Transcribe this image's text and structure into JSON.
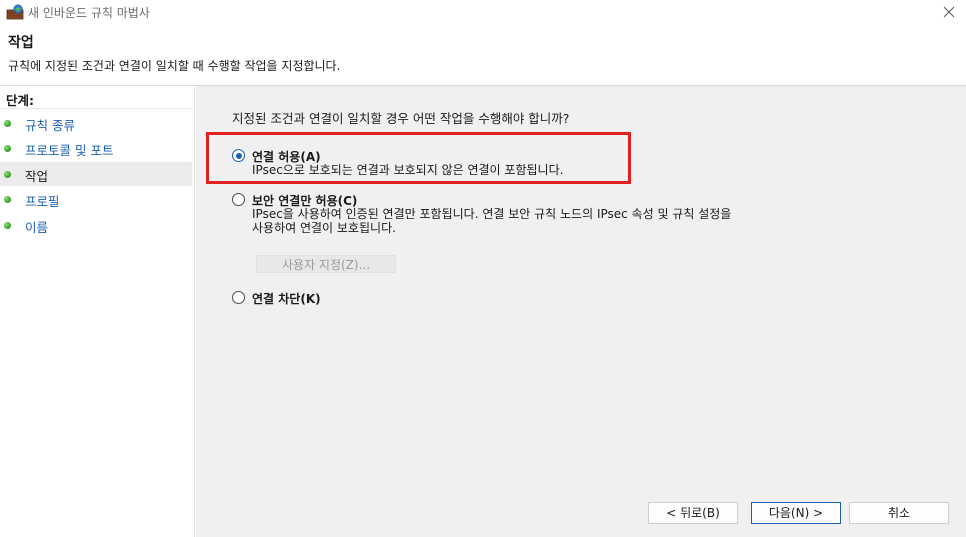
{
  "window": {
    "title": "새 인바운드 규칙 마법사"
  },
  "header": {
    "title": "작업",
    "description": "규칙에 지정된 조건과 연결이 일치할 때 수행할 작업을 지정합니다."
  },
  "sidebar": {
    "steps_label": "단계:",
    "items": [
      {
        "label": "규칙 종류",
        "active": false
      },
      {
        "label": "프로토콜 및 포트",
        "active": false
      },
      {
        "label": "작업",
        "active": true
      },
      {
        "label": "프로필",
        "active": false
      },
      {
        "label": "이름",
        "active": false
      }
    ]
  },
  "main": {
    "question": "지정된 조건과 연결이 일치할 경우 어떤 작업을 수행해야 합니까?",
    "options": [
      {
        "label": "연결 허용(A)",
        "desc1": "IPsec으로 보호되는 연결과 보호되지 않은 연결이 포함됩니다.",
        "checked": true
      },
      {
        "label": "보안 연결만 허용(C)",
        "desc1": "IPsec을 사용하여 인증된 연결만 포함됩니다. 연결 보안 규칙 노드의 IPsec 속성 및 규칙 설정을",
        "desc2": "사용하여 연결이 보호됩니다.",
        "checked": false
      },
      {
        "label": "연결 차단(K)",
        "checked": false
      }
    ],
    "custom_button": "사용자 지정(Z)..."
  },
  "footer": {
    "back": "< 뒤로(B)",
    "next": "다음(N) >",
    "cancel": "취소"
  },
  "colors": {
    "accent": "#1a5fb4",
    "highlight": "#e02020",
    "step_dot": "#3aa52a",
    "panel_bg": "#f0f0f0"
  },
  "icons": {
    "app": "firewall-icon",
    "close": "close-icon",
    "step": "step-dot-icon"
  }
}
